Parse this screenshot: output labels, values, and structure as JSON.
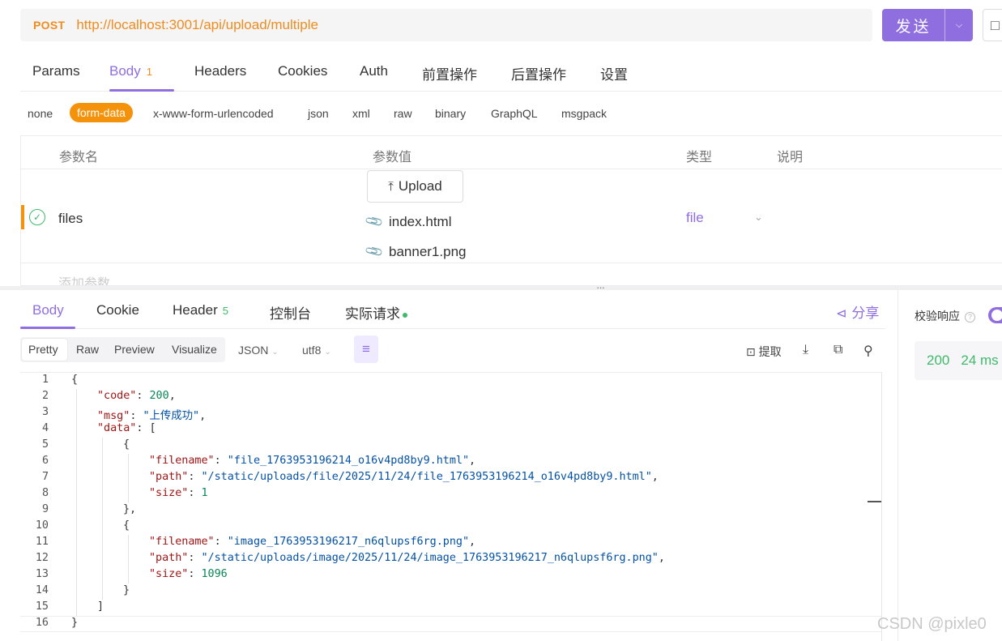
{
  "request": {
    "method": "POST",
    "url": "http://localhost:3001/api/upload/multiple",
    "send_label": "发送",
    "colors": {
      "accent": "#8f6ee0",
      "method": "#f08c1e",
      "success": "#3fb96b"
    }
  },
  "req_tabs": {
    "params": "Params",
    "body": "Body",
    "body_count": "1",
    "headers": "Headers",
    "cookies": "Cookies",
    "auth": "Auth",
    "pre": "前置操作",
    "post": "后置操作",
    "settings": "设置"
  },
  "body_types": {
    "none": "none",
    "form_data": "form-data",
    "urlencoded": "x-www-form-urlencoded",
    "json": "json",
    "xml": "xml",
    "raw": "raw",
    "binary": "binary",
    "graphql": "GraphQL",
    "msgpack": "msgpack"
  },
  "params_table": {
    "col_name": "参数名",
    "col_value": "参数值",
    "col_type": "类型",
    "col_desc": "说明",
    "row": {
      "name": "files",
      "upload_label": "Upload",
      "files": [
        "index.html",
        "banner1.png"
      ],
      "type": "file"
    },
    "add_placeholder": "添加参数"
  },
  "resp_tabs": {
    "body": "Body",
    "cookie": "Cookie",
    "header": "Header",
    "header_count": "5",
    "console": "控制台",
    "actual": "实际请求",
    "share": "分享"
  },
  "resp_toolbar": {
    "pretty": "Pretty",
    "raw": "Raw",
    "preview": "Preview",
    "visualize": "Visualize",
    "format": "JSON",
    "encoding": "utf8",
    "extract": "提取"
  },
  "right_panel": {
    "validate_label": "校验响应",
    "status": "200",
    "time": "24 ms"
  },
  "code": {
    "line_numbers": [
      "1",
      "2",
      "3",
      "4",
      "5",
      "6",
      "7",
      "8",
      "9",
      "10",
      "11",
      "12",
      "13",
      "14",
      "15",
      "16"
    ],
    "lines": [
      {
        "indent": 0,
        "parts": [
          [
            "p",
            "{"
          ]
        ]
      },
      {
        "indent": 1,
        "parts": [
          [
            "k",
            "\"code\""
          ],
          [
            "p",
            ": "
          ],
          [
            "n",
            "200"
          ],
          [
            "p",
            ","
          ]
        ]
      },
      {
        "indent": 1,
        "parts": [
          [
            "k",
            "\"msg\""
          ],
          [
            "p",
            ": "
          ],
          [
            "s",
            "\"上传成功\""
          ],
          [
            "p",
            ","
          ]
        ]
      },
      {
        "indent": 1,
        "parts": [
          [
            "k",
            "\"data\""
          ],
          [
            "p",
            ": ["
          ]
        ]
      },
      {
        "indent": 2,
        "parts": [
          [
            "p",
            "{"
          ]
        ]
      },
      {
        "indent": 3,
        "parts": [
          [
            "k",
            "\"filename\""
          ],
          [
            "p",
            ": "
          ],
          [
            "s",
            "\"file_1763953196214_o16v4pd8by9.html\""
          ],
          [
            "p",
            ","
          ]
        ]
      },
      {
        "indent": 3,
        "parts": [
          [
            "k",
            "\"path\""
          ],
          [
            "p",
            ": "
          ],
          [
            "s",
            "\"/static/uploads/file/2025/11/24/file_1763953196214_o16v4pd8by9.html\""
          ],
          [
            "p",
            ","
          ]
        ]
      },
      {
        "indent": 3,
        "parts": [
          [
            "k",
            "\"size\""
          ],
          [
            "p",
            ": "
          ],
          [
            "n",
            "1"
          ]
        ]
      },
      {
        "indent": 2,
        "parts": [
          [
            "p",
            "},"
          ]
        ]
      },
      {
        "indent": 2,
        "parts": [
          [
            "p",
            "{"
          ]
        ]
      },
      {
        "indent": 3,
        "parts": [
          [
            "k",
            "\"filename\""
          ],
          [
            "p",
            ": "
          ],
          [
            "s",
            "\"image_1763953196217_n6qlupsf6rg.png\""
          ],
          [
            "p",
            ","
          ]
        ]
      },
      {
        "indent": 3,
        "parts": [
          [
            "k",
            "\"path\""
          ],
          [
            "p",
            ": "
          ],
          [
            "s",
            "\"/static/uploads/image/2025/11/24/image_1763953196217_n6qlupsf6rg.png\""
          ],
          [
            "p",
            ","
          ]
        ]
      },
      {
        "indent": 3,
        "parts": [
          [
            "k",
            "\"size\""
          ],
          [
            "p",
            ": "
          ],
          [
            "n",
            "1096"
          ]
        ]
      },
      {
        "indent": 2,
        "parts": [
          [
            "p",
            "}"
          ]
        ]
      },
      {
        "indent": 1,
        "parts": [
          [
            "p",
            "]"
          ]
        ]
      },
      {
        "indent": 0,
        "parts": [
          [
            "p",
            "}"
          ]
        ]
      }
    ]
  },
  "watermark": "CSDN @pixle0"
}
